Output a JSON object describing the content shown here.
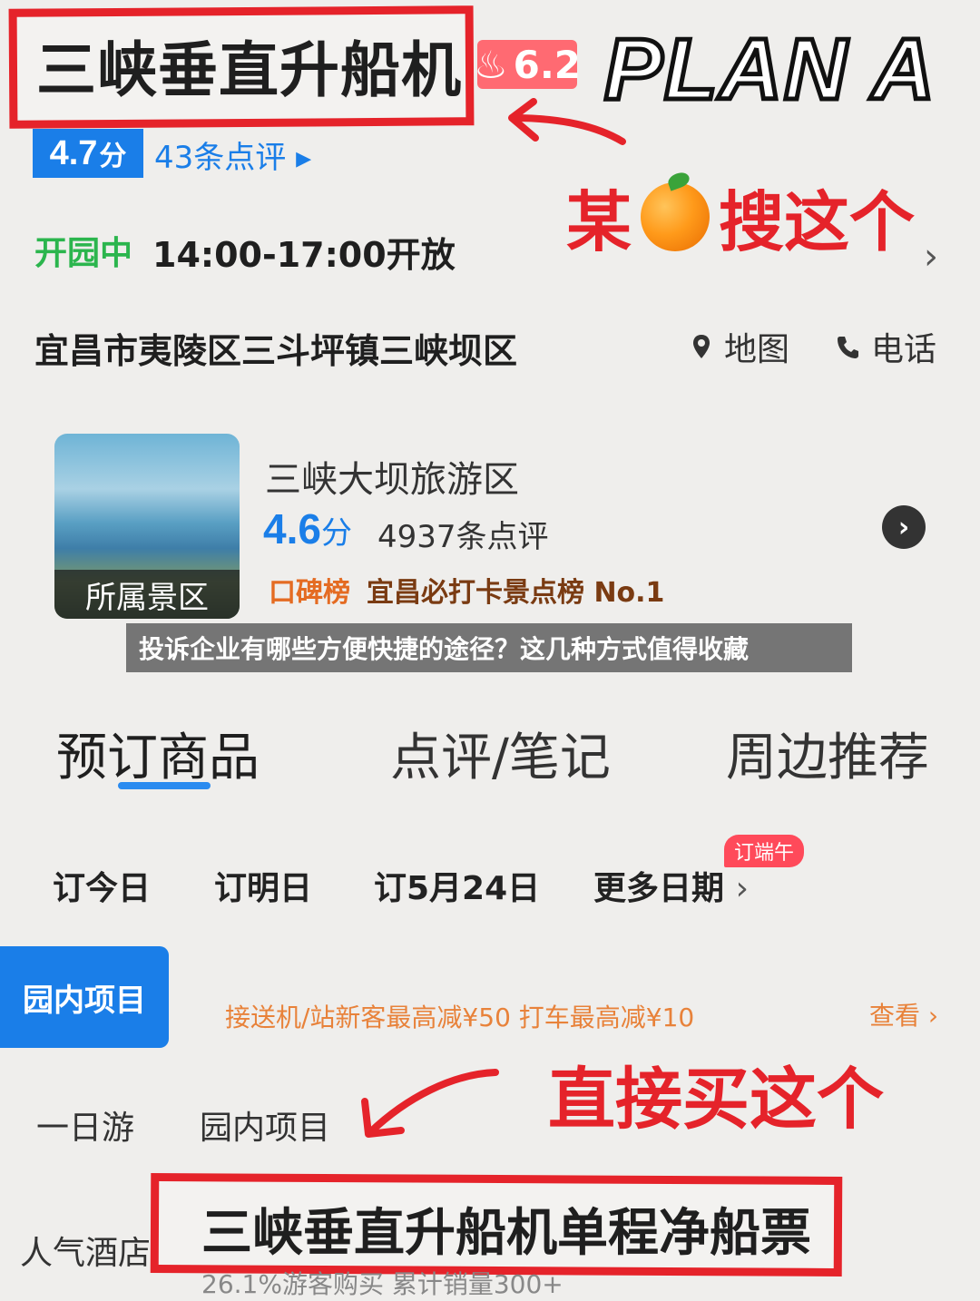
{
  "header": {
    "title": "三峡垂直升船机",
    "hot_score": "6.2",
    "plan_label": "PLAN A",
    "rating": "4.7",
    "rating_unit": "分",
    "review_link": "43条点评 ▸",
    "search_note_left": "某",
    "search_note_right": "搜这个",
    "open_status": "开园中",
    "open_hours": "14:00-17:00开放",
    "address": "宜昌市夷陵区三斗坪镇三峡坝区",
    "map_label": "地图",
    "phone_label": "电话"
  },
  "scenic": {
    "thumb_label": "所属景区",
    "name": "三峡大坝旅游区",
    "score": "4.6",
    "score_unit": "分",
    "reviews": "4937条点评",
    "rank_badge": "口碑榜",
    "rank_text": "宜昌必打卡景点榜 No.1"
  },
  "caption": "投诉企业有哪些方便快捷的途径？这几种方式值得收藏",
  "tabs": [
    {
      "label": "预订商品",
      "active": true
    },
    {
      "label": "点评/笔记",
      "active": false
    },
    {
      "label": "周边推荐",
      "active": false
    }
  ],
  "dates": [
    "订今日",
    "订明日",
    "订5月24日",
    "更多日期"
  ],
  "dragon_badge": "订端午",
  "side_tab": "园内项目",
  "promo": "接送机/站新客最高减¥50  打车最高减¥10",
  "promo_more": "查看",
  "buy_note": "直接买这个",
  "subtabs": [
    "一日游",
    "园内项目"
  ],
  "hotel_label": "人气酒店",
  "ticket": {
    "name": "三峡垂直升船机单程净船票",
    "meta": "26.1%游客购买  累计销量300+"
  },
  "colors": {
    "accent_blue": "#1a7ee8",
    "annotation_red": "#e5232a",
    "open_green": "#2bb54d",
    "promo_orange": "#e8823a"
  }
}
